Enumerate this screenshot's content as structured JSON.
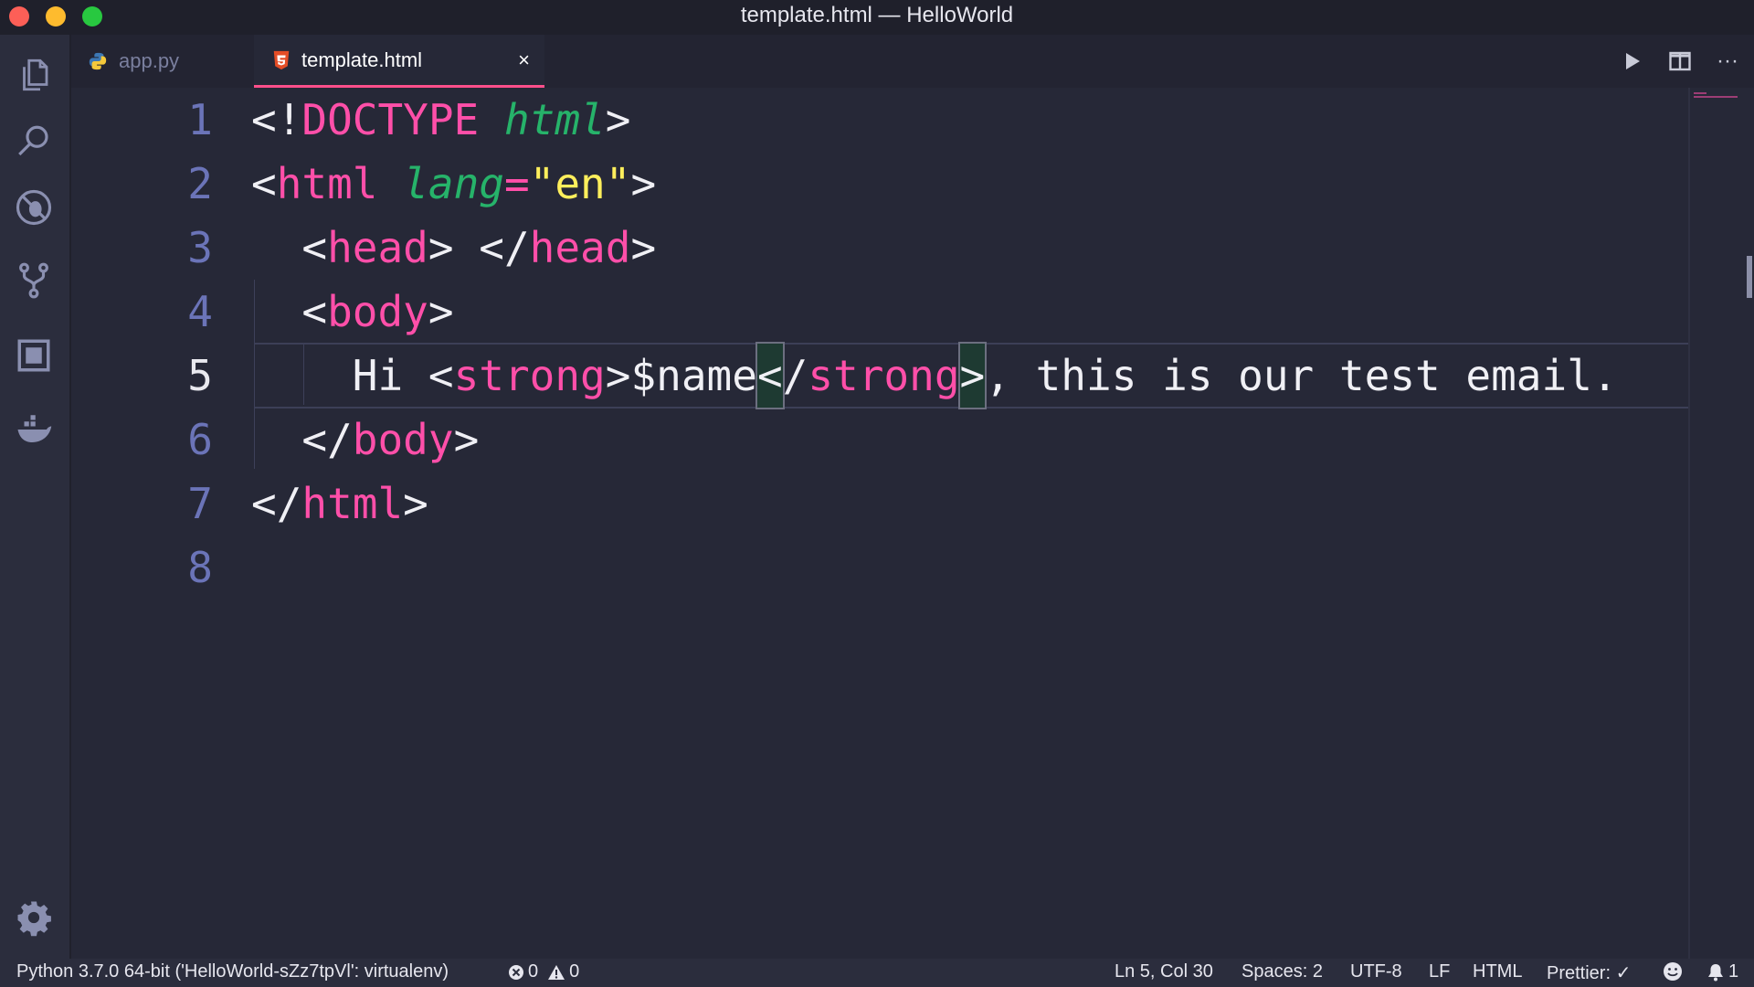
{
  "window": {
    "title": "template.html — HelloWorld"
  },
  "activity_bar": {
    "icons": [
      "files-icon",
      "search-icon",
      "debug-icon",
      "source-control-icon",
      "extensions-icon",
      "docker-icon",
      "gear-icon"
    ]
  },
  "tabs": [
    {
      "label": "app.py",
      "icon": "python-file-icon",
      "active": false
    },
    {
      "label": "template.html",
      "icon": "html5-file-icon",
      "active": true,
      "close": "×"
    }
  ],
  "editor_actions": {
    "run": "▶",
    "split": "split-editor-icon",
    "more": "···"
  },
  "editor": {
    "current_line": 5,
    "lines": [
      {
        "n": "1",
        "tokens": [
          [
            "punc",
            "<!"
          ],
          [
            "kw",
            "DOCTYPE"
          ],
          [
            "punc",
            " "
          ],
          [
            "attr",
            "html"
          ],
          [
            "punc",
            ">"
          ]
        ]
      },
      {
        "n": "2",
        "tokens": [
          [
            "punc",
            "<"
          ],
          [
            "tag",
            "html"
          ],
          [
            "punc",
            " "
          ],
          [
            "attr",
            "lang"
          ],
          [
            "tag",
            "="
          ],
          [
            "str",
            "\"en\""
          ],
          [
            "punc",
            ">"
          ]
        ]
      },
      {
        "n": "3",
        "tokens": [
          [
            "punc",
            "  <"
          ],
          [
            "tag",
            "head"
          ],
          [
            "punc",
            "> </"
          ],
          [
            "tag",
            "head"
          ],
          [
            "punc",
            ">"
          ]
        ]
      },
      {
        "n": "4",
        "tokens": [
          [
            "punc",
            "  <"
          ],
          [
            "tag",
            "body"
          ],
          [
            "punc",
            ">"
          ]
        ]
      },
      {
        "n": "5",
        "tokens": [
          [
            "text",
            "    Hi "
          ],
          [
            "punc",
            "<"
          ],
          [
            "tag",
            "strong"
          ],
          [
            "punc",
            ">"
          ],
          [
            "text",
            "$name"
          ],
          [
            "bracket",
            "<"
          ],
          [
            "punc",
            "/"
          ],
          [
            "tag",
            "strong"
          ],
          [
            "bracket",
            ">"
          ],
          [
            "text",
            ", this is our test email."
          ]
        ]
      },
      {
        "n": "6",
        "tokens": [
          [
            "punc",
            "  </"
          ],
          [
            "tag",
            "body"
          ],
          [
            "punc",
            ">"
          ]
        ]
      },
      {
        "n": "7",
        "tokens": [
          [
            "punc",
            "</"
          ],
          [
            "tag",
            "html"
          ],
          [
            "punc",
            ">"
          ]
        ]
      },
      {
        "n": "8",
        "tokens": []
      }
    ]
  },
  "status_bar": {
    "interpreter": "Python 3.7.0 64-bit ('HelloWorld-sZz7tpVl': virtualenv)",
    "errors": "0",
    "warnings": "0",
    "cursor": "Ln 5, Col 30",
    "spaces": "Spaces: 2",
    "encoding": "UTF-8",
    "eol": "LF",
    "language": "HTML",
    "formatter": "Prettier: ✓",
    "notifications": "1"
  },
  "colors": {
    "tag": "#ff4fa9",
    "attribute": "#26b36a",
    "string": "#ffef5c",
    "line_number": "#6b74b8",
    "background": "#262837"
  }
}
